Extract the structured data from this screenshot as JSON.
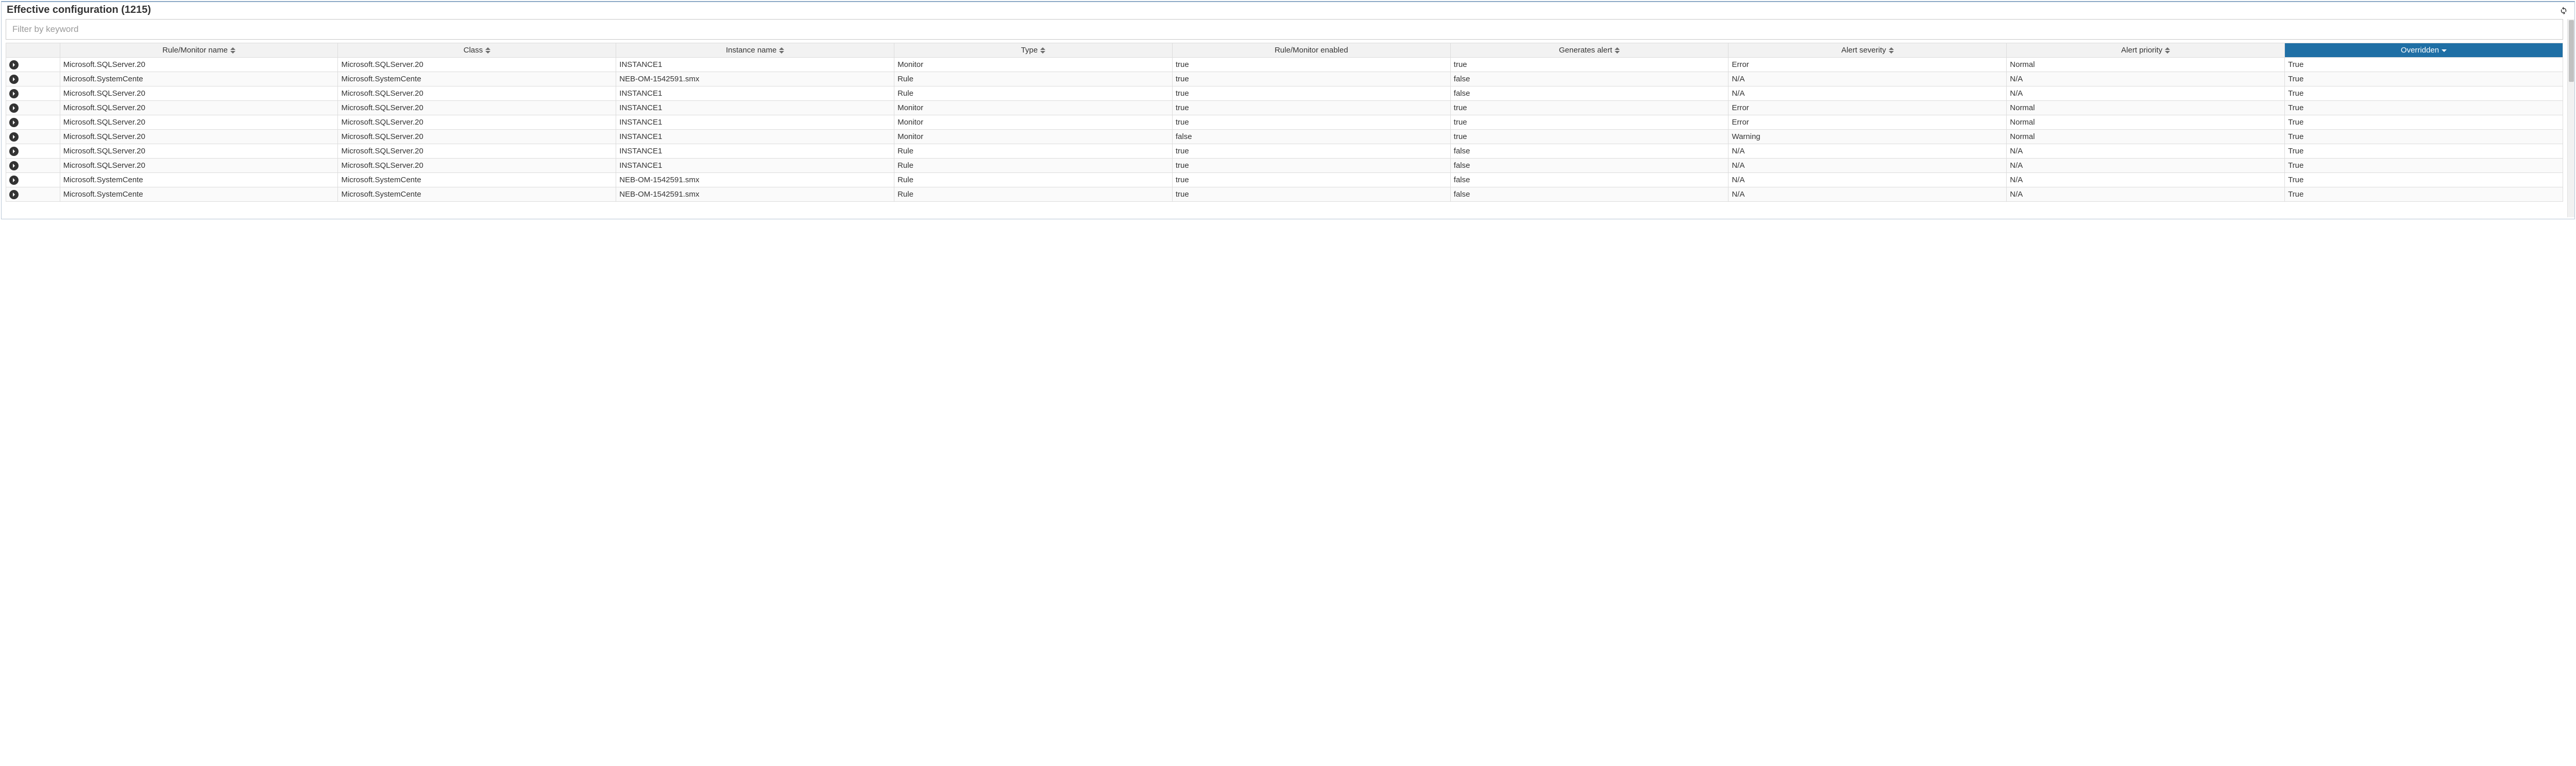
{
  "header": {
    "title": "Effective configuration (1215)"
  },
  "filter": {
    "placeholder": "Filter by keyword",
    "value": ""
  },
  "columns": {
    "name": "Rule/Monitor name",
    "class": "Class",
    "instance": "Instance name",
    "type": "Type",
    "enabled": "Rule/Monitor enabled",
    "generates_alert": "Generates alert",
    "severity": "Alert severity",
    "priority": "Alert priority",
    "overridden": "Overridden"
  },
  "rows": [
    {
      "name": "Microsoft.SQLServer.20",
      "class": "Microsoft.SQLServer.20",
      "instance": "INSTANCE1",
      "type": "Monitor",
      "enabled": "true",
      "generates_alert": "true",
      "severity": "Error",
      "priority": "Normal",
      "overridden": "True"
    },
    {
      "name": "Microsoft.SystemCente",
      "class": "Microsoft.SystemCente",
      "instance": "NEB-OM-1542591.smx",
      "type": "Rule",
      "enabled": "true",
      "generates_alert": "false",
      "severity": "N/A",
      "priority": "N/A",
      "overridden": "True"
    },
    {
      "name": "Microsoft.SQLServer.20",
      "class": "Microsoft.SQLServer.20",
      "instance": "INSTANCE1",
      "type": "Rule",
      "enabled": "true",
      "generates_alert": "false",
      "severity": "N/A",
      "priority": "N/A",
      "overridden": "True"
    },
    {
      "name": "Microsoft.SQLServer.20",
      "class": "Microsoft.SQLServer.20",
      "instance": "INSTANCE1",
      "type": "Monitor",
      "enabled": "true",
      "generates_alert": "true",
      "severity": "Error",
      "priority": "Normal",
      "overridden": "True"
    },
    {
      "name": "Microsoft.SQLServer.20",
      "class": "Microsoft.SQLServer.20",
      "instance": "INSTANCE1",
      "type": "Monitor",
      "enabled": "true",
      "generates_alert": "true",
      "severity": "Error",
      "priority": "Normal",
      "overridden": "True"
    },
    {
      "name": "Microsoft.SQLServer.20",
      "class": "Microsoft.SQLServer.20",
      "instance": "INSTANCE1",
      "type": "Monitor",
      "enabled": "false",
      "generates_alert": "true",
      "severity": "Warning",
      "priority": "Normal",
      "overridden": "True"
    },
    {
      "name": "Microsoft.SQLServer.20",
      "class": "Microsoft.SQLServer.20",
      "instance": "INSTANCE1",
      "type": "Rule",
      "enabled": "true",
      "generates_alert": "false",
      "severity": "N/A",
      "priority": "N/A",
      "overridden": "True"
    },
    {
      "name": "Microsoft.SQLServer.20",
      "class": "Microsoft.SQLServer.20",
      "instance": "INSTANCE1",
      "type": "Rule",
      "enabled": "true",
      "generates_alert": "false",
      "severity": "N/A",
      "priority": "N/A",
      "overridden": "True"
    },
    {
      "name": "Microsoft.SystemCente",
      "class": "Microsoft.SystemCente",
      "instance": "NEB-OM-1542591.smx",
      "type": "Rule",
      "enabled": "true",
      "generates_alert": "false",
      "severity": "N/A",
      "priority": "N/A",
      "overridden": "True"
    },
    {
      "name": "Microsoft.SystemCente",
      "class": "Microsoft.SystemCente",
      "instance": "NEB-OM-1542591.smx",
      "type": "Rule",
      "enabled": "true",
      "generates_alert": "false",
      "severity": "N/A",
      "priority": "N/A",
      "overridden": "True"
    }
  ]
}
